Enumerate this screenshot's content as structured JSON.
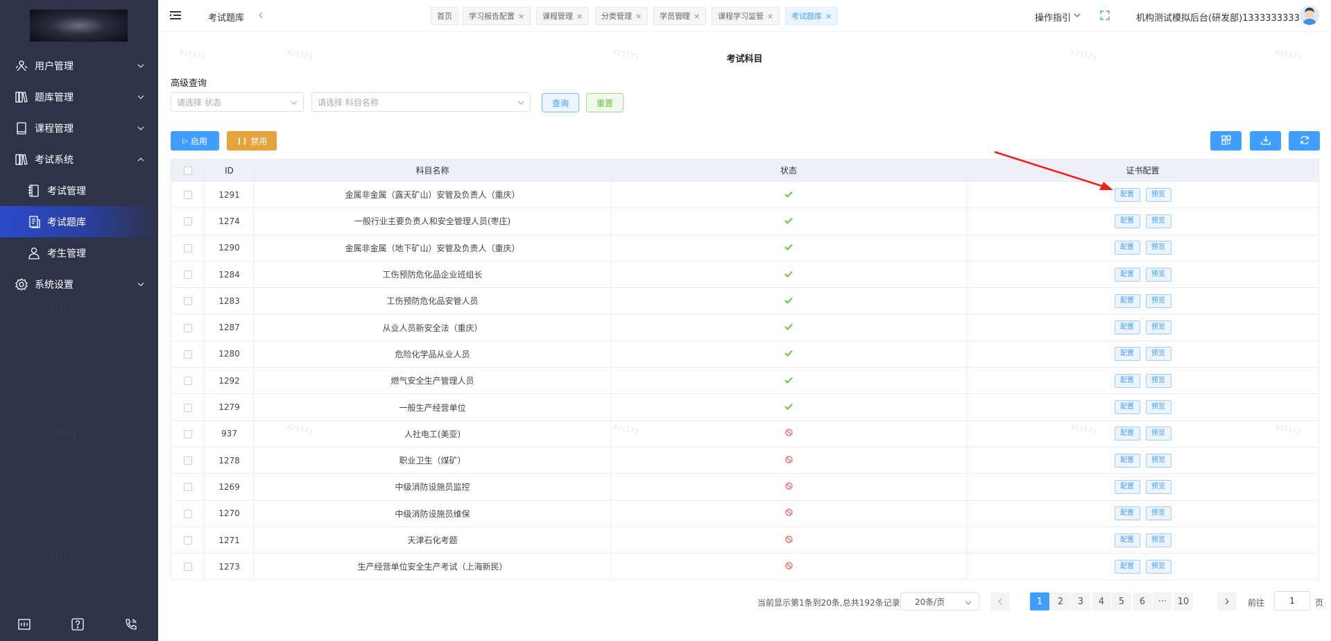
{
  "sidebar": {
    "menu": [
      {
        "label": "用户管理",
        "icon": "user-group-icon",
        "expanded": false
      },
      {
        "label": "题库管理",
        "icon": "books-icon",
        "expanded": false
      },
      {
        "label": "课程管理",
        "icon": "book-icon",
        "expanded": false
      },
      {
        "label": "考试系统",
        "icon": "library-icon",
        "expanded": true
      },
      {
        "label": "考试管理",
        "icon": "notebook-icon",
        "sub": true
      },
      {
        "label": "考试题库",
        "icon": "document-list-icon",
        "sub": true,
        "active": true
      },
      {
        "label": "考生管理",
        "icon": "person-icon",
        "sub": true
      },
      {
        "label": "系统设置",
        "icon": "gear-icon",
        "expanded": false
      }
    ],
    "bottom_icons": [
      "code-window-icon",
      "help-icon",
      "phone-icon"
    ]
  },
  "topbar": {
    "page_name": "考试题库",
    "tabs": [
      {
        "label": "首页",
        "closable": false
      },
      {
        "label": "学习报告配置",
        "closable": true
      },
      {
        "label": "课程管理",
        "closable": true
      },
      {
        "label": "分类管理",
        "closable": true
      },
      {
        "label": "学员管理",
        "closable": true
      },
      {
        "label": "课程学习监管",
        "closable": true
      },
      {
        "label": "考试题库",
        "closable": true,
        "active": true
      }
    ],
    "guide": "操作指引",
    "user": "机构测试模拟后台(研发部)1333333333"
  },
  "main": {
    "title": "考试科目",
    "advanced_search": "高级查询",
    "status_placeholder": "请选择 状态",
    "subject_placeholder": "请选择 科目名称",
    "search_btn": "查询",
    "reset_btn": "重置",
    "enable_btn": "启用",
    "disable_btn": "禁用"
  },
  "table": {
    "headers": {
      "id": "ID",
      "name": "科目名称",
      "status": "状态",
      "cert": "证书配置"
    },
    "config_label": "配置",
    "preview_label": "预览",
    "rows": [
      {
        "id": "1291",
        "name": "金属非金属（露天矿山）安管及负责人（重庆）",
        "enabled": true
      },
      {
        "id": "1274",
        "name": "一般行业主要负责人和安全管理人员(枣庄)",
        "enabled": true
      },
      {
        "id": "1290",
        "name": "金属非金属（地下矿山）安管及负责人（重庆）",
        "enabled": true
      },
      {
        "id": "1284",
        "name": "工伤预防危化品企业班组长",
        "enabled": true
      },
      {
        "id": "1283",
        "name": "工伤预防危化品安管人员",
        "enabled": true
      },
      {
        "id": "1287",
        "name": "从业人员新安全法（重庆）",
        "enabled": true
      },
      {
        "id": "1280",
        "name": "危险化学品从业人员",
        "enabled": true
      },
      {
        "id": "1292",
        "name": "燃气安全生产管理人员",
        "enabled": true
      },
      {
        "id": "1279",
        "name": "一般生产经营单位",
        "enabled": true
      },
      {
        "id": "937",
        "name": "人社电工(美亚)",
        "enabled": false
      },
      {
        "id": "1278",
        "name": "职业卫生（煤矿）",
        "enabled": false
      },
      {
        "id": "1269",
        "name": "中级消防设施员监控",
        "enabled": false
      },
      {
        "id": "1270",
        "name": "中级消防设施员维保",
        "enabled": false
      },
      {
        "id": "1271",
        "name": "天津石化考题",
        "enabled": false
      },
      {
        "id": "1273",
        "name": "生产经营单位安全生产考试（上海新民）",
        "enabled": false
      }
    ]
  },
  "pagination": {
    "summary": "当前显示第1条到20条,总共192条记录",
    "page_size": "20条/页",
    "pages": [
      "1",
      "2",
      "3",
      "4",
      "5",
      "6",
      "···",
      "10"
    ],
    "current": "1",
    "goto_label": "前往",
    "goto_value": "1",
    "unit": "页"
  },
  "watermark": "421173",
  "colors": {
    "sidebar_bg": "#2e3349",
    "primary": "#409eff",
    "warning": "#e6a23c",
    "success": "#67c23a",
    "danger": "#f56c6c",
    "annotation_arrow": "#f0201b"
  }
}
